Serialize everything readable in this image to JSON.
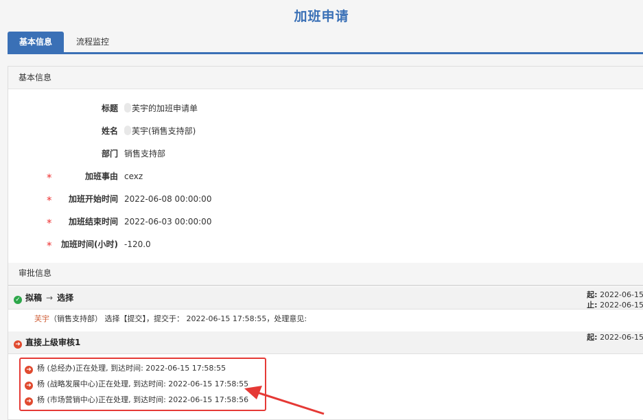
{
  "title": "加班申请",
  "tabs": [
    {
      "label": "基本信息"
    },
    {
      "label": "流程监控"
    }
  ],
  "basic_section": "基本信息",
  "fields": {
    "subject": {
      "label": "标题",
      "value": "芙宇的加班申请单"
    },
    "name": {
      "label": "姓名",
      "value": "芙宇(销售支持部)"
    },
    "department": {
      "label": "部门",
      "value": "销售支持部"
    },
    "reason": {
      "label": "加班事由",
      "value": "cexz",
      "required": true
    },
    "start": {
      "label": "加班开始时间",
      "value": "2022-06-08 00:00:00",
      "required": true
    },
    "end": {
      "label": "加班结束时间",
      "value": "2022-06-03 00:00:00",
      "required": true
    },
    "hours": {
      "label": "加班时间(小时)",
      "value": "-120.0",
      "required": true
    }
  },
  "approval_section": "审批信息",
  "required_mark": "*",
  "steps": [
    {
      "from": "拟稿",
      "arrow": "→",
      "to": "选择",
      "start_label": "起:",
      "start_time": "2022-06-15",
      "end_label": "止:",
      "end_time": "2022-06-15",
      "detail_who": "芙宇",
      "detail_text": "（销售支持部） 选择【提交】，提交于： 2022-06-15 17:58:55，处理意见:"
    },
    {
      "title": "直接上级审核1",
      "start_label": "起:",
      "start_time": "2022-06-15",
      "handlers": [
        {
          "text": "杨 (总经办)正在处理, 到达时间: 2022-06-15 17:58:55"
        },
        {
          "text": "杨 (战略发展中心)正在处理, 到达时间: 2022-06-15 17:58:55"
        },
        {
          "text": "杨 (市场营销中心)正在处理, 到达时间: 2022-06-15 17:58:56"
        }
      ]
    }
  ],
  "colors": {
    "accent": "#3a70b6",
    "highlight": "#e53935",
    "success": "#2da74a"
  }
}
